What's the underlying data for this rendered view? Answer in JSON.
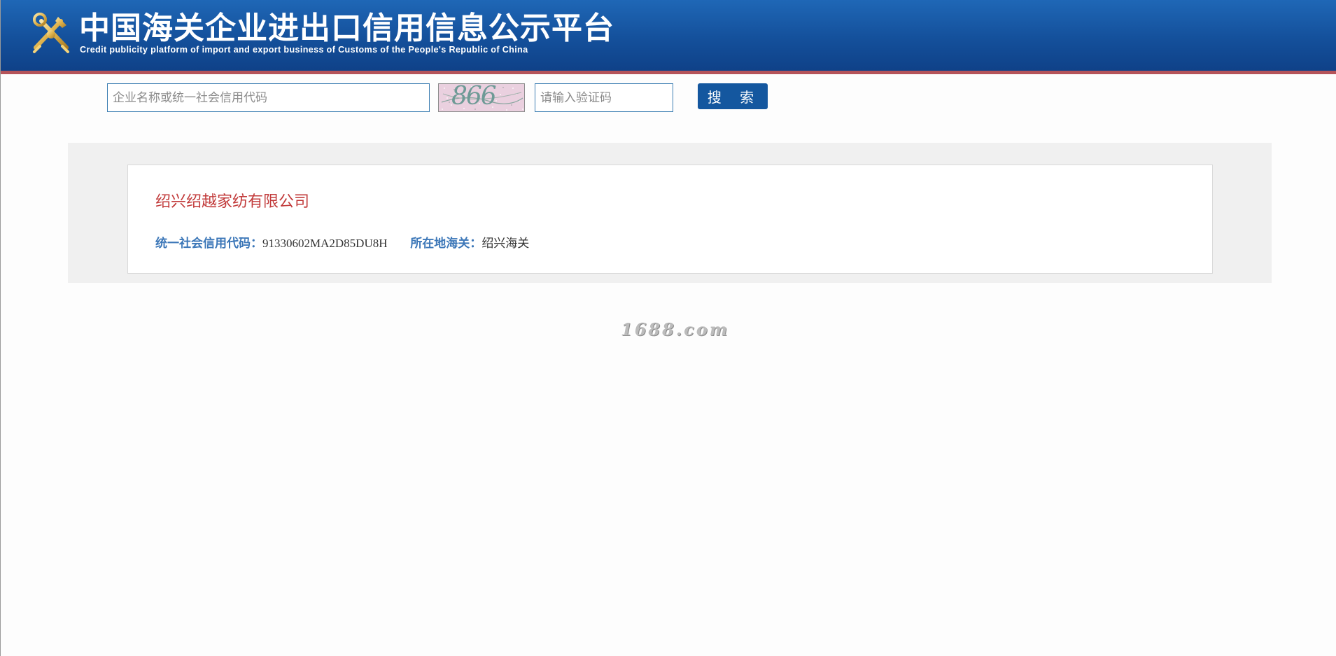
{
  "header": {
    "title_cn": "中国海关企业进出口信用信息公示平台",
    "title_en": "Credit publicity platform of import and export business of Customs of the People's Republic of China",
    "background": "#1658a6",
    "accent_line": "#b5545a",
    "logo_icon": "customs-emblem-icon"
  },
  "search": {
    "company_placeholder": "企业名称或统一社会信用代码",
    "company_value": "",
    "captcha_text": "866",
    "code_placeholder": "请输入验证码",
    "code_value": "",
    "button_label": "搜 索",
    "button_color": "#14579f"
  },
  "result": {
    "company_name": "绍兴绍越家纺有限公司",
    "credit_code_label": "统一社会信用代码：",
    "credit_code_value": "91330602MA2D85DU8H",
    "customs_label": "所在地海关：",
    "customs_value": "绍兴海关",
    "name_color": "#c23b3b",
    "label_color": "#3c77b8"
  },
  "watermark": "1688.com"
}
